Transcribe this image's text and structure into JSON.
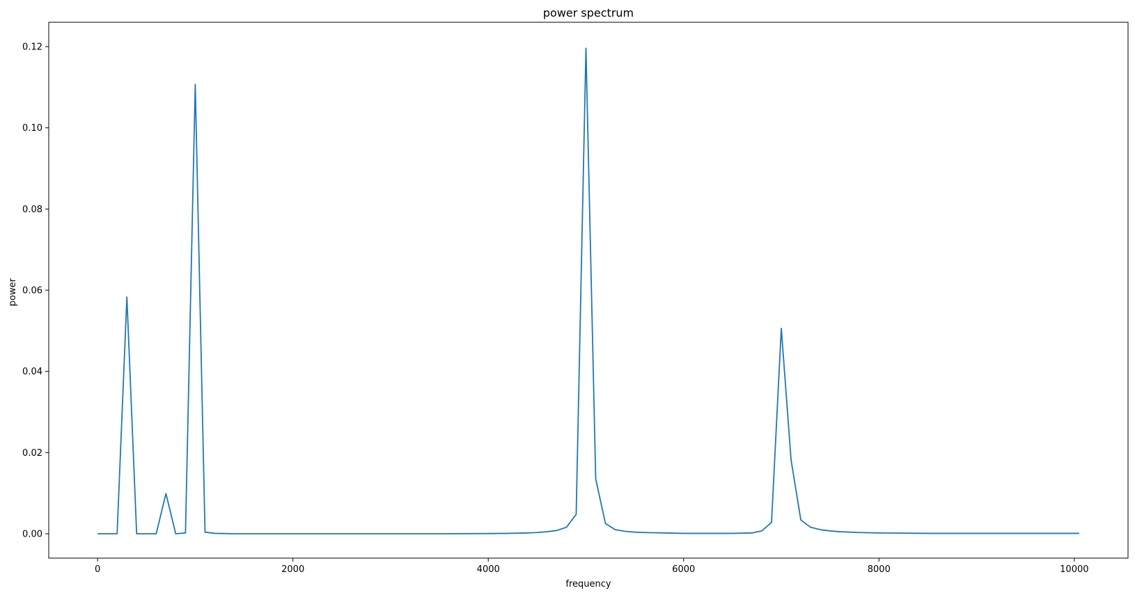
{
  "chart_data": {
    "type": "line",
    "title": "power spectrum",
    "xlabel": "frequency",
    "ylabel": "power",
    "xlim": [
      -500,
      10550
    ],
    "ylim": [
      -0.006,
      0.126
    ],
    "xticks": [
      0,
      2000,
      4000,
      6000,
      8000,
      10000
    ],
    "xtick_labels": [
      "0",
      "2000",
      "4000",
      "6000",
      "8000",
      "10000"
    ],
    "yticks": [
      0.0,
      0.02,
      0.04,
      0.06,
      0.08,
      0.1,
      0.12
    ],
    "ytick_labels": [
      "0.00",
      "0.02",
      "0.04",
      "0.06",
      "0.08",
      "0.10",
      "0.12"
    ],
    "grid": false,
    "legend": "none",
    "series": [
      {
        "color": "#1f77b4",
        "x": [
          0,
          100,
          200,
          300,
          400,
          500,
          600,
          700,
          800,
          900,
          1000,
          1100,
          1200,
          1300,
          1400,
          1600,
          2000,
          2500,
          3000,
          3500,
          4000,
          4200,
          4400,
          4500,
          4600,
          4700,
          4800,
          4900,
          5000,
          5100,
          5200,
          5300,
          5400,
          5500,
          5600,
          5800,
          6000,
          6300,
          6500,
          6700,
          6800,
          6900,
          7000,
          7100,
          7200,
          7300,
          7400,
          7500,
          7600,
          7800,
          8000,
          8500,
          9000,
          9500,
          10050
        ],
        "y": [
          0.0,
          0.0,
          0.0,
          0.0583,
          0.0,
          0.0,
          0.0,
          0.0099,
          0.0,
          0.0002,
          0.1107,
          0.0004,
          0.0001,
          5e-05,
          0.0,
          0.0,
          0.0,
          0.0,
          0.0,
          0.0,
          5e-05,
          0.0001,
          0.0002,
          0.0003,
          0.0005,
          0.0008,
          0.0016,
          0.0048,
          0.1196,
          0.0135,
          0.0025,
          0.001,
          0.0006,
          0.0004,
          0.0003,
          0.0002,
          0.0001,
          0.0001,
          0.0001,
          0.0002,
          0.0007,
          0.0028,
          0.0506,
          0.0182,
          0.0034,
          0.0016,
          0.001,
          0.0007,
          0.0005,
          0.0003,
          0.0002,
          0.0001,
          0.0001,
          0.0001,
          0.0001
        ]
      }
    ]
  }
}
